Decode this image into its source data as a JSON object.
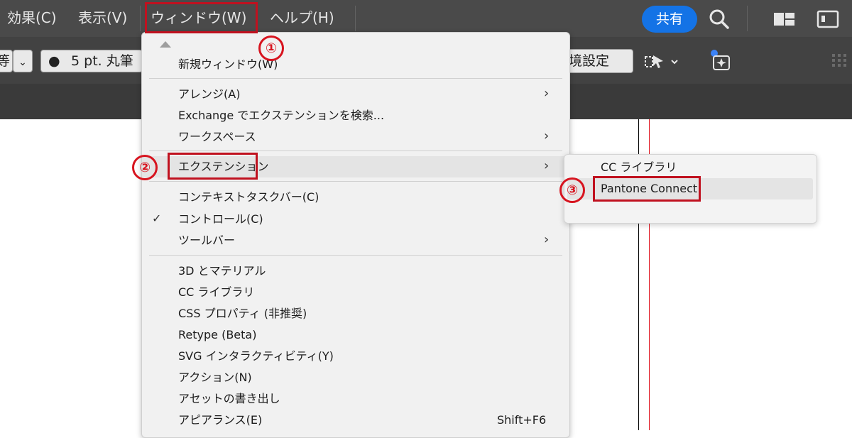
{
  "menubar": {
    "items": [
      {
        "label": "効果(C)"
      },
      {
        "label": "表示(V)"
      },
      {
        "label": "ウィンドウ(W)"
      },
      {
        "label": "ヘルプ(H)"
      }
    ],
    "share_label": "共有",
    "share_color": "#1473e6",
    "icons": [
      "search-icon",
      "arrange-documents-icon",
      "panel-layout-icon"
    ]
  },
  "control_bar": {
    "left_partial_text": "等",
    "stroke_profile": "5 pt. 丸筆",
    "prefs_partial_text": "境設定",
    "icons": [
      "align-icon",
      "sparkle-magic-icon",
      "grip-handle-icon"
    ]
  },
  "window_menu": {
    "items": [
      {
        "label": "新規ウィンドウ(W)"
      },
      {
        "label": "アレンジ(A)",
        "submenu": true
      },
      {
        "label": "Exchange でエクステンションを検索..."
      },
      {
        "label": "ワークスペース",
        "submenu": true
      },
      {
        "label": "エクステンション",
        "submenu": true,
        "highlighted": true
      },
      {
        "label": "コンテキストタスクバー(C)"
      },
      {
        "label": "コントロール(C)",
        "checked": true
      },
      {
        "label": "ツールバー",
        "submenu": true
      },
      {
        "label": "3D とマテリアル"
      },
      {
        "label": "CC ライブラリ"
      },
      {
        "label": "CSS プロパティ (非推奨)"
      },
      {
        "label": "Retype (Beta)"
      },
      {
        "label": "SVG インタラクティビティ(Y)"
      },
      {
        "label": "アクション(N)"
      },
      {
        "label": "アセットの書き出し"
      },
      {
        "label": "アピアランス(E)",
        "shortcut": "Shift+F6"
      }
    ],
    "chevron": "›",
    "checkmark": "✓"
  },
  "extensions_submenu": {
    "items": [
      {
        "label": "CC ライブラリ"
      },
      {
        "label": "Pantone Connect",
        "highlighted": true
      }
    ]
  },
  "annotations": {
    "step1": "①",
    "step2": "②",
    "step3": "③",
    "color": "#c0111f"
  },
  "guide_colors": {
    "black_line": "#000000",
    "red_line": "#e0141e"
  }
}
